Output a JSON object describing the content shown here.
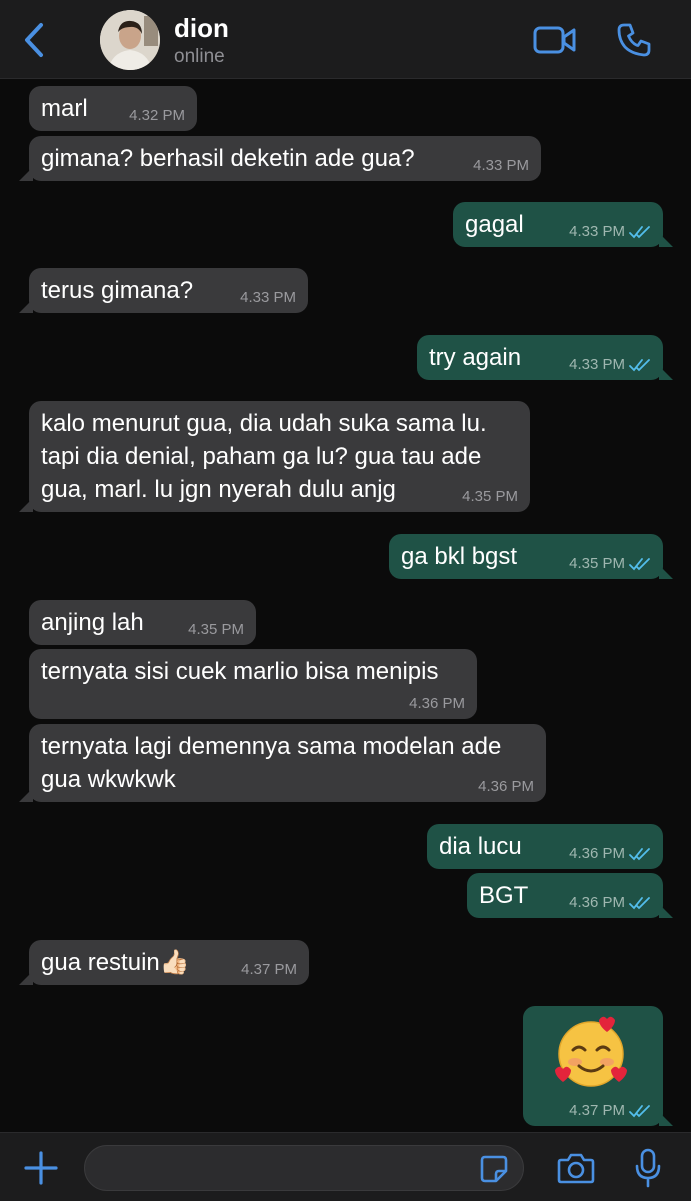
{
  "colors": {
    "accent": "#4a90e2",
    "incoming_bubble": "#3a3a3c",
    "outgoing_bubble": "#1f5246",
    "read_ticks": "#53bdeb"
  },
  "header": {
    "back_icon": "chevron-left-icon",
    "contact_name": "dion",
    "status": "online",
    "video_icon": "video-camera-icon",
    "call_icon": "phone-icon"
  },
  "messages": [
    {
      "dir": "in",
      "text": "marl",
      "time": "4.32 PM"
    },
    {
      "dir": "in",
      "text": "gimana? berhasil deketin ade gua?",
      "time": "4.33 PM"
    },
    {
      "dir": "out",
      "text": "gagal",
      "time": "4.33 PM"
    },
    {
      "dir": "in",
      "text": "terus gimana?",
      "time": "4.33 PM"
    },
    {
      "dir": "out",
      "text": "try again",
      "time": "4.33 PM"
    },
    {
      "dir": "in",
      "text": "kalo menurut gua, dia udah suka sama lu.\ntapi dia denial, paham ga lu? gua tau ade\ngua, marl. lu jgn nyerah dulu anjg",
      "time": "4.35 PM"
    },
    {
      "dir": "out",
      "text": "ga bkl bgst",
      "time": "4.35 PM"
    },
    {
      "dir": "in",
      "text": "anjing lah",
      "time": "4.35 PM"
    },
    {
      "dir": "in",
      "text": "ternyata sisi cuek marlio bisa menipis",
      "time": "4.36 PM"
    },
    {
      "dir": "in",
      "text": "ternyata lagi demennya sama modelan ade\ngua wkwkwk",
      "time": "4.36 PM"
    },
    {
      "dir": "out",
      "text": "dia lucu",
      "time": "4.36 PM"
    },
    {
      "dir": "out",
      "text": "BGT",
      "time": "4.36 PM"
    },
    {
      "dir": "in",
      "text": "gua restuin👍🏻",
      "time": "4.37 PM"
    },
    {
      "dir": "out",
      "text": "",
      "emoji": "smiling-face-with-hearts-emoji",
      "time": "4.37 PM"
    }
  ],
  "input": {
    "plus_icon": "plus-icon",
    "placeholder": "",
    "sticker_icon": "sticker-icon",
    "camera_icon": "camera-icon",
    "mic_icon": "microphone-icon"
  }
}
